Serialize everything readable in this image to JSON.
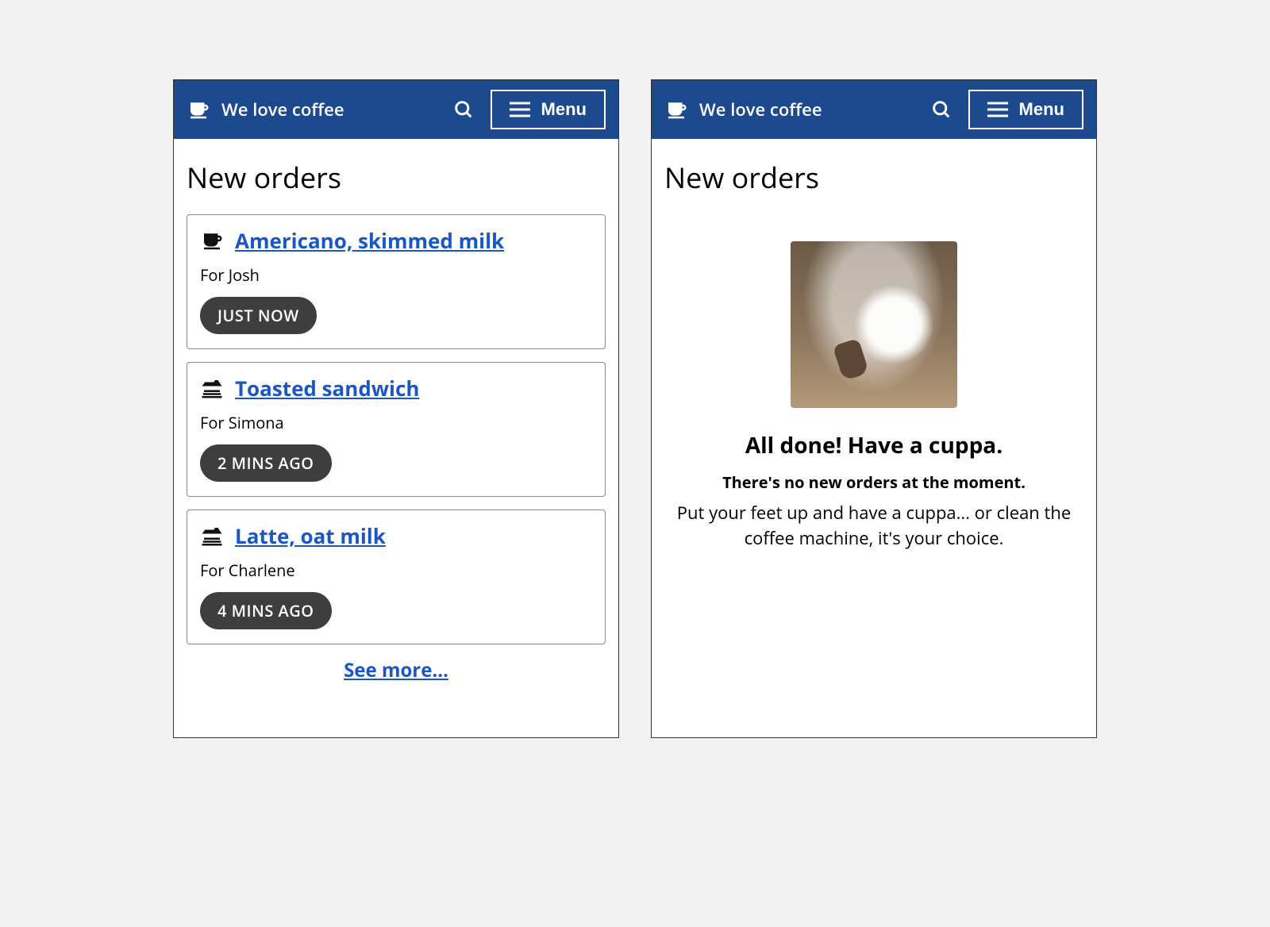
{
  "header": {
    "app_title": "We love coffee",
    "menu_label": "Menu"
  },
  "left": {
    "page_title": "New orders",
    "orders": [
      {
        "icon": "coffee",
        "title": "Americano, skimmed milk",
        "for": "For Josh",
        "time": "JUST NOW"
      },
      {
        "icon": "food",
        "title": "Toasted sandwich",
        "for": "For Simona",
        "time": "2 MINS AGO"
      },
      {
        "icon": "food",
        "title": "Latte, oat milk",
        "for": "For Charlene",
        "time": "4 MINS AGO"
      }
    ],
    "see_more": "See more..."
  },
  "right": {
    "page_title": "New orders",
    "empty_title": "All done! Have a cuppa.",
    "empty_sub": "There's no new orders at the moment.",
    "empty_body": "Put your feet up and have a cuppa... or clean the coffee machine, it's your choice."
  }
}
